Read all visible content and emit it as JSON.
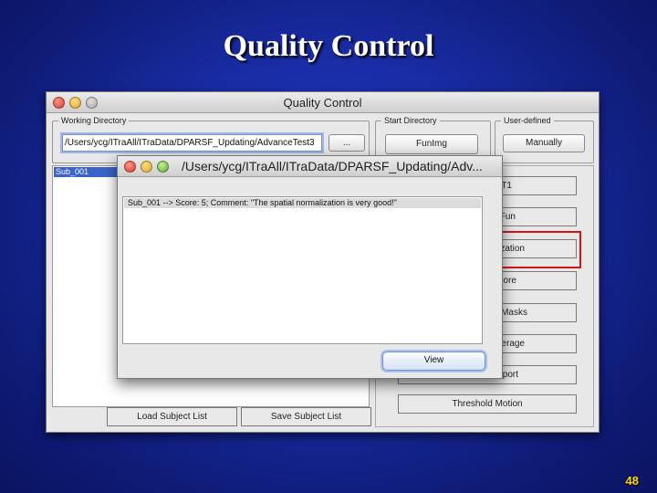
{
  "slide": {
    "title": "Quality Control",
    "page_number": "48"
  },
  "main_window": {
    "title": "Quality Control",
    "working_directory": {
      "legend": "Working Directory",
      "path": "/Users/ycg/ITraAll/ITraData/DPARSF_Updating/AdvanceTest3",
      "browse_label": "..."
    },
    "start_directory": {
      "legend": "Start Directory",
      "button_label": "FunImg"
    },
    "user_defined": {
      "legend": "User-defined",
      "button_label": "Manually"
    },
    "subjects": [
      "Sub_001"
    ],
    "right_buttons": [
      {
        "label": "T1"
      },
      {
        "label": "Fun"
      },
      {
        "label": "zation"
      },
      {
        "label": "Score"
      },
      {
        "label": "p Masks"
      },
      {
        "label": "verage"
      },
      {
        "label": "port"
      },
      {
        "label": "Threshold Motion"
      }
    ],
    "load_subject_list_label": "Load Subject List",
    "save_subject_list_label": "Save Subject List"
  },
  "dialog": {
    "title": "/Users/ycg/ITraAll/ITraData/DPARSF_Updating/Adv...",
    "line": "Sub_001 --> Score: 5; Comment: \"The spatial normalization is very good!\"",
    "view_label": "View"
  },
  "colors": {
    "highlight": "#d41515",
    "selection": "#3b63c9",
    "slide_bg": "#1a2da8",
    "page_number": "#ffd800"
  }
}
